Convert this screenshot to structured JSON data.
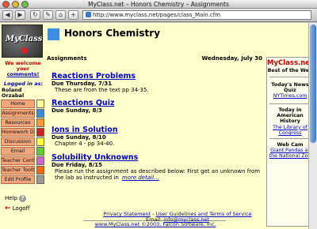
{
  "window": {
    "title": "MyClass.net – Honors Chemistry – Assignments"
  },
  "toolbar": {
    "url": "http://www.myclass.net/pages/class_Main.cfm"
  },
  "left": {
    "logo": "MyClass",
    "welcome_prefix": "We welcome your",
    "welcome_link": "comments!",
    "logged_label": "Logged in as:",
    "logged_user": "Roland Orzabal",
    "nav": [
      {
        "label": "Home",
        "color": "#ffff99"
      },
      {
        "label": "Assignments",
        "color": "#3b8be0"
      },
      {
        "label": "Resources",
        "color": "#ff9933"
      },
      {
        "label": "Homework Drop",
        "color": "#cc2222"
      },
      {
        "label": "Discussion",
        "color": "#ffff33"
      },
      {
        "label": "Email",
        "color": "#66cc33"
      },
      {
        "label": "Teacher Center",
        "color": "#cc66cc"
      },
      {
        "label": "Teacher Toolbox",
        "color": "#ff6600"
      },
      {
        "label": "Edit Profile",
        "color": "#999999"
      }
    ],
    "help": "Help",
    "logoff": "Logoff"
  },
  "main": {
    "title": "Honors Chemistry",
    "section": "Assignments",
    "date": "Wednesday, July 30",
    "assignments": [
      {
        "title": "Reactions Problems",
        "due": "Due Thursday, 7/31",
        "desc": "These are from the text pp 34-35."
      },
      {
        "title": "Reactions Quiz",
        "due": "Due Sunday, 8/3",
        "desc": ""
      },
      {
        "title": "Ions in Solution",
        "due": "Due Sunday, 8/10",
        "desc": "Chapter 4 - pp 34-40."
      },
      {
        "title": "Solubility Unknowns",
        "due": "Due Friday, 8/15",
        "desc": "Please run the assignment as described below: First get an unknown from the lab as instructed in",
        "more": "more detail..."
      }
    ],
    "footer": {
      "line1": "www.MyClass.net ©2003, Falcon Software, Inc.",
      "privacy": "Privacy Statement",
      "sep": " - ",
      "guidelines": "User Guidelines and Terms of Service",
      "email_label": "Email: ",
      "email": "info@myclass.net"
    }
  },
  "right": {
    "brand": "MyClass.net",
    "brand_sub": "Best of the Web",
    "quiz_head": "Today's News Quiz",
    "quiz_link": "NYTimes.com",
    "history_head": "Today in American History",
    "history_link": "The Library of Congress",
    "webcam_head": "Web Cam",
    "webcam_link": "Giant Pandas at the National Zoo"
  },
  "colors": {
    "page_bg": "#ffffcc",
    "link": "#0000cc",
    "accent": "#3d8ee0",
    "nav_bg": "#f3a57a"
  }
}
